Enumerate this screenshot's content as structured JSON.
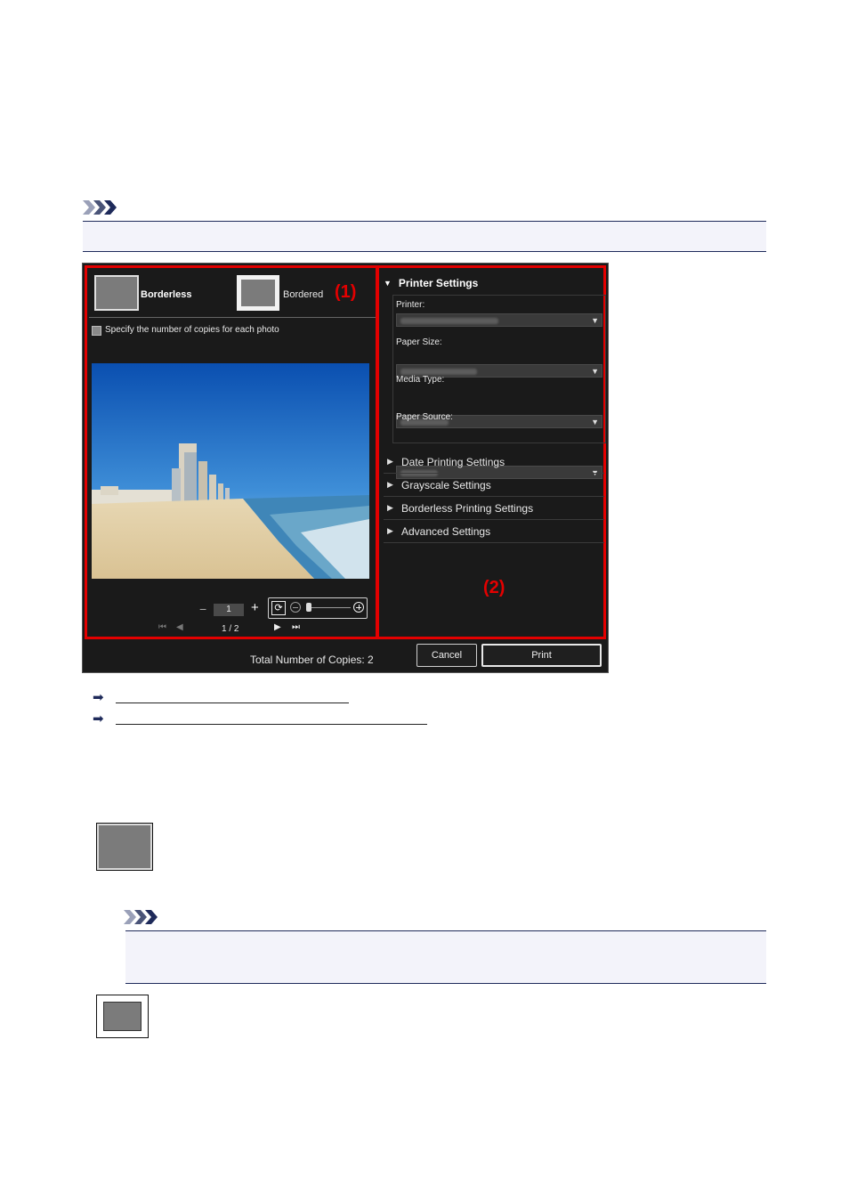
{
  "dialog": {
    "layout_options": [
      {
        "label": "Borderless"
      },
      {
        "label": "Bordered"
      }
    ],
    "callout_1": "(1)",
    "callout_2": "(2)",
    "copies_checkbox_label": "Specify the number of copies for each photo",
    "copies_value": "1",
    "minus_glyph": "−",
    "plus_glyph": "+",
    "page_indicator": "1 / 2",
    "printer_settings": {
      "title": "Printer Settings",
      "fields": [
        {
          "label": "Printer:"
        },
        {
          "label": "Paper Size:"
        },
        {
          "label": "Media Type:"
        },
        {
          "label": "Paper Source:"
        }
      ]
    },
    "collapsed_sections": [
      "Date Printing Settings",
      "Grayscale Settings",
      "Borderless Printing Settings",
      "Advanced Settings"
    ],
    "total_copies_label": "Total Number of Copies:  2",
    "cancel_label": "Cancel",
    "print_label": "Print"
  },
  "colors": {
    "callout_red": "#e30000",
    "dialog_bg": "#1a1a1a",
    "note_navy": "#1e2a5a"
  }
}
